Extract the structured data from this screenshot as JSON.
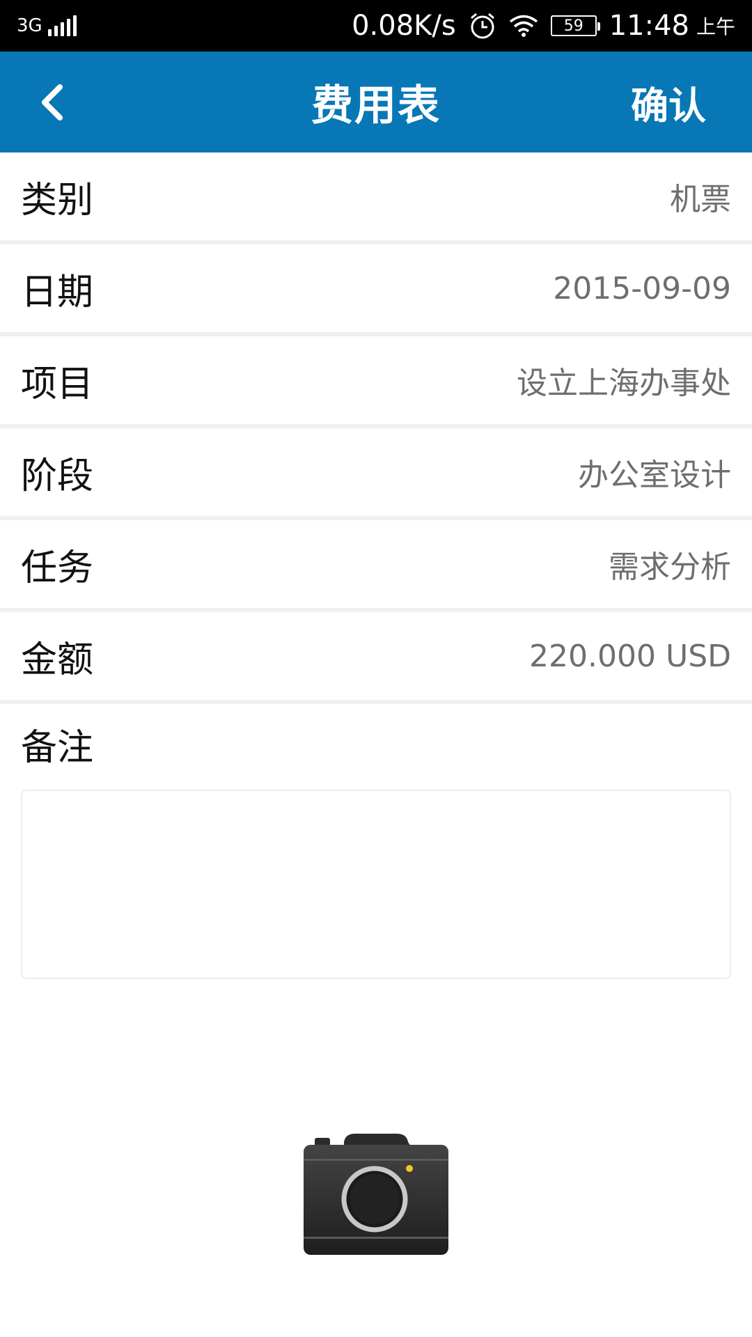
{
  "status_bar": {
    "network": "3G",
    "speed": "0.08K/s",
    "battery": "59",
    "time": "11:48",
    "ampm": "上午"
  },
  "nav": {
    "title": "费用表",
    "confirm_label": "确认",
    "back_icon": "chevron-left-icon"
  },
  "form": {
    "rows": [
      {
        "label": "类别",
        "value": "机票"
      },
      {
        "label": "日期",
        "value": "2015-09-09"
      },
      {
        "label": "项目",
        "value": "设立上海办事处"
      },
      {
        "label": "阶段",
        "value": "办公室设计"
      },
      {
        "label": "任务",
        "value": "需求分析"
      },
      {
        "label": "金额",
        "value": "220.000 USD"
      }
    ],
    "remark_label": "备注",
    "remark_value": ""
  },
  "camera_icon": "camera-icon",
  "colors": {
    "nav_bg": "#0777b6",
    "status_bg": "#000000",
    "divider": "#eef0f2",
    "value_text": "#6e6e6e"
  }
}
